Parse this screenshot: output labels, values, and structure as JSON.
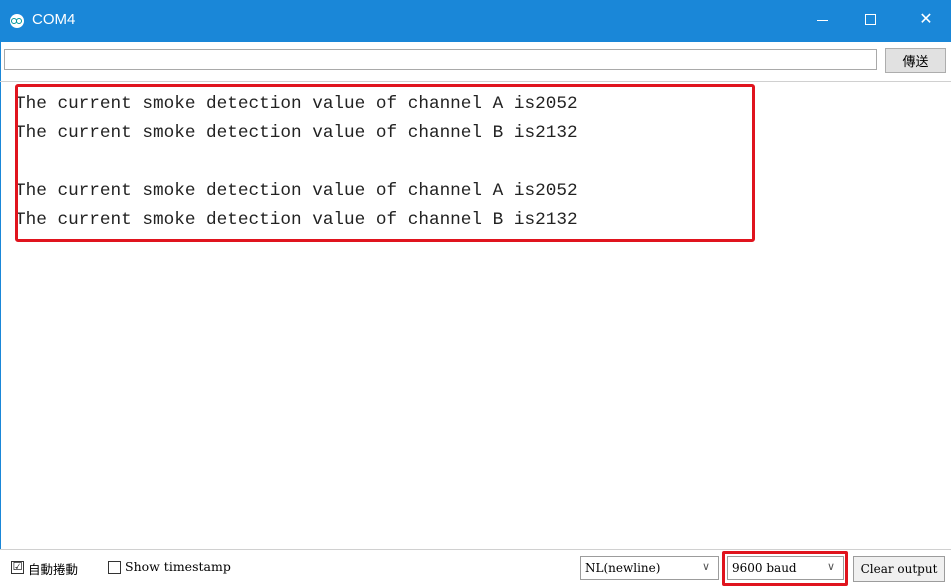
{
  "window": {
    "title": "COM4",
    "minimize": "",
    "maximize": "",
    "close": "✕"
  },
  "send": {
    "input_value": "",
    "button_label": "傳送"
  },
  "output": {
    "lines": [
      "The current smoke detection value of channel A is2052",
      "The current smoke detection value of channel B is2132",
      "",
      "The current smoke detection value of channel A is2052",
      "The current smoke detection value of channel B is2132"
    ]
  },
  "footer": {
    "autoscroll_checked": "☑",
    "autoscroll_label": "自動捲動",
    "timestamp_checked": "",
    "timestamp_label": "Show timestamp",
    "line_ending": "NL(newline)",
    "baud_rate": "9600 baud",
    "dropdown_arrow": "∨",
    "clear_label": "Clear output"
  },
  "colors": {
    "titlebar": "#1a87d8",
    "highlight": "#e0141e"
  }
}
